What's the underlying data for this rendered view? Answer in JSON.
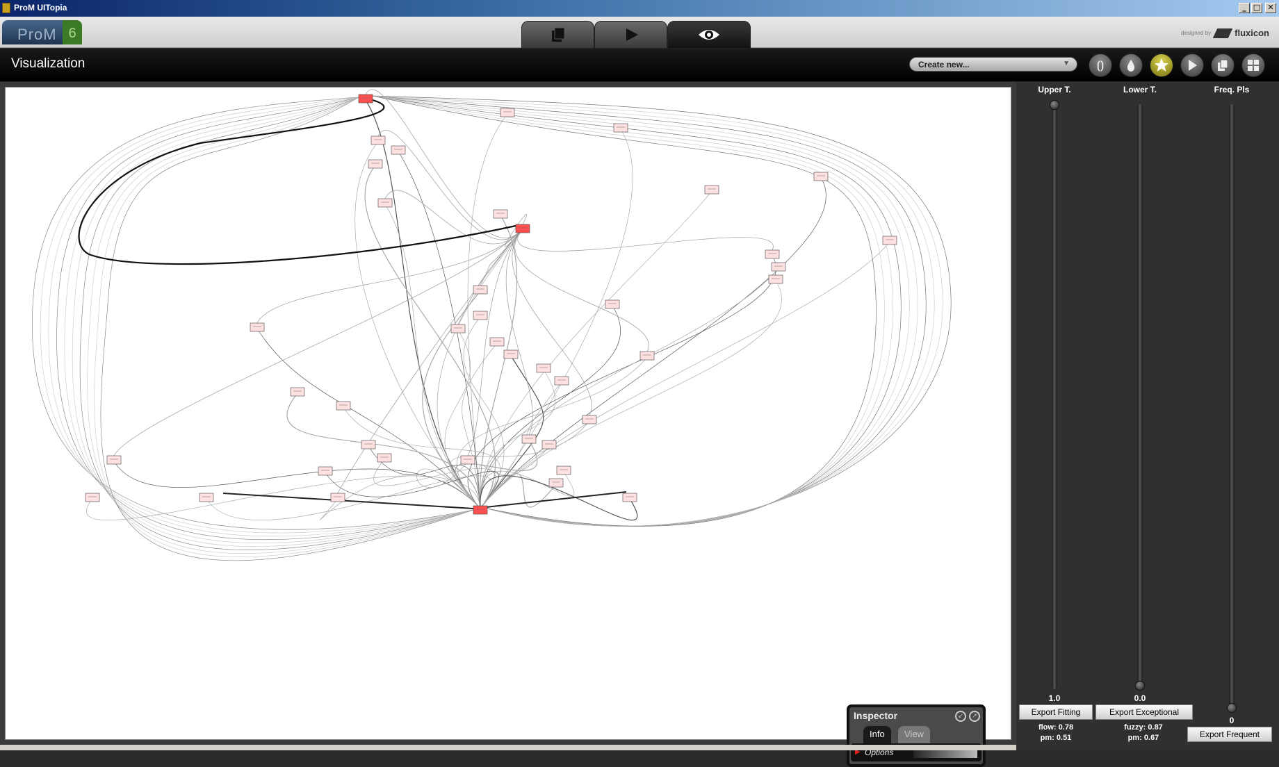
{
  "window": {
    "title": "ProM UITopia",
    "controls": [
      "_",
      "□",
      "✕"
    ]
  },
  "header": {
    "logo_text": "ProM",
    "logo_version": "6",
    "tabs": [
      {
        "icon": "workspace-icon",
        "active": false
      },
      {
        "icon": "play-icon",
        "active": false
      },
      {
        "icon": "eye-icon",
        "active": true
      }
    ],
    "brand_designed_by": "designed by",
    "brand_name": "fluxicon"
  },
  "toolbar": {
    "title": "Visualization",
    "create_select": "Create new...",
    "buttons": [
      "refresh-icon",
      "drop-icon",
      "star-icon",
      "play-icon",
      "copy-icon",
      "grid-icon"
    ]
  },
  "colors": {
    "node_fill_strong": "#ff5050",
    "node_fill_light": "#fde0e0",
    "accent_star": "#b5ad20"
  },
  "inspector": {
    "title": "Inspector",
    "tabs": [
      "Info",
      "View"
    ],
    "active_tab": "Info",
    "section": "Options"
  },
  "side": {
    "sliders": [
      {
        "label": "Upper T.",
        "value": "1.0",
        "level": 1.0
      },
      {
        "label": "Lower T.",
        "value": "0.0",
        "level": 0.0
      },
      {
        "label": "Freq. Pls",
        "value": "0",
        "level": 0.0
      }
    ],
    "exports": {
      "fitting": "Export Fitting",
      "exceptional": "Export Exceptional",
      "frequent": "Export Frequent"
    },
    "metrics": {
      "flow": "flow: 0.78",
      "pm1": "pm: 0.51",
      "fuzzy": "fuzzy: 0.87",
      "pm2": "pm: 0.67"
    }
  }
}
